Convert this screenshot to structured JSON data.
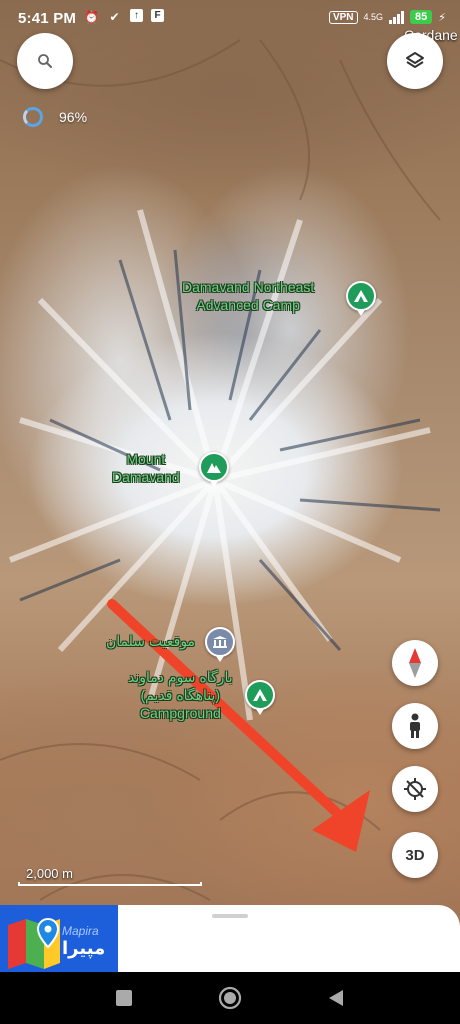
{
  "status_bar": {
    "time": "5:41 PM",
    "left_icons": [
      "alarm-icon",
      "check-icon",
      "upload-icon",
      "app-icon"
    ],
    "vpn": "VPN",
    "network": "4.5G",
    "battery": "85"
  },
  "map": {
    "loading_percent": "96%",
    "edge_label": "Cardane",
    "labels": [
      {
        "id": "northeast-camp",
        "text_line1": "Damavand Northeast",
        "text_line2": "Advanced Camp",
        "icon": "tent-icon"
      },
      {
        "id": "mount-damavand",
        "text_line1": "Mount",
        "text_line2": "Damavand",
        "icon": "mountain-icon"
      },
      {
        "id": "salman-site",
        "text_line1": "موقعیت سلمان",
        "text_line2": "",
        "icon": "museum-icon"
      },
      {
        "id": "old-camp",
        "text_line1": "بارگاه سوم دماوند",
        "text_line2": "(پناهگاه قدیم)",
        "text_line3": "Campground",
        "icon": "tent-icon"
      }
    ],
    "scale": "2,000 m"
  },
  "controls": {
    "search_icon": "search-icon",
    "layers_icon": "layers-icon",
    "compass_icon": "compass-icon",
    "streetview_icon": "pegman-icon",
    "locate_icon": "my-location-icon",
    "toggle_3d_label": "3D"
  },
  "annotation": {
    "arrow_color": "#f0442a"
  },
  "ad_banner": {
    "brand_en": "Mapira",
    "brand_fa": "مپیرا"
  },
  "nav_bar": {
    "buttons": [
      "recents-button",
      "home-button",
      "back-button"
    ]
  }
}
